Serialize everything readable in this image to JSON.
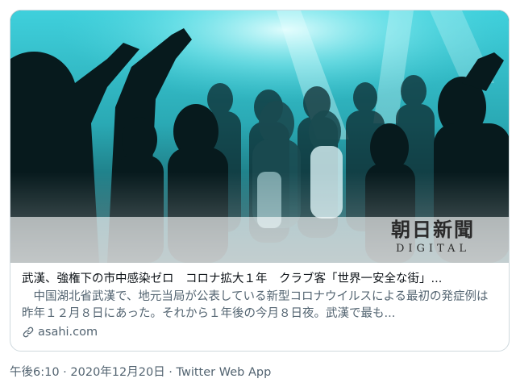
{
  "card": {
    "image": {
      "logo_main": "朝日新聞",
      "logo_sub": "DIGITAL"
    },
    "title": "武漢、強権下の市中感染ゼロ　コロナ拡大１年　クラブ客「世界一安全な街」...",
    "description": "　中国湖北省武漢で、地元当局が公表している新型コロナウイルスによる最初の発症例は昨年１２月８日にあった。それから１年後の今月８日夜。武漢で最も...",
    "domain": "asahi.com",
    "link_icon": "link-icon"
  },
  "meta": {
    "time": "午後6:10",
    "separator1": " · ",
    "date": "2020年12月20日",
    "separator2": " · ",
    "source": "Twitter Web App"
  },
  "colors": {
    "border": "#cfd9de",
    "secondary_text": "#536471",
    "primary_text": "#0f1419",
    "photo_teal": "#3fc4cc"
  }
}
